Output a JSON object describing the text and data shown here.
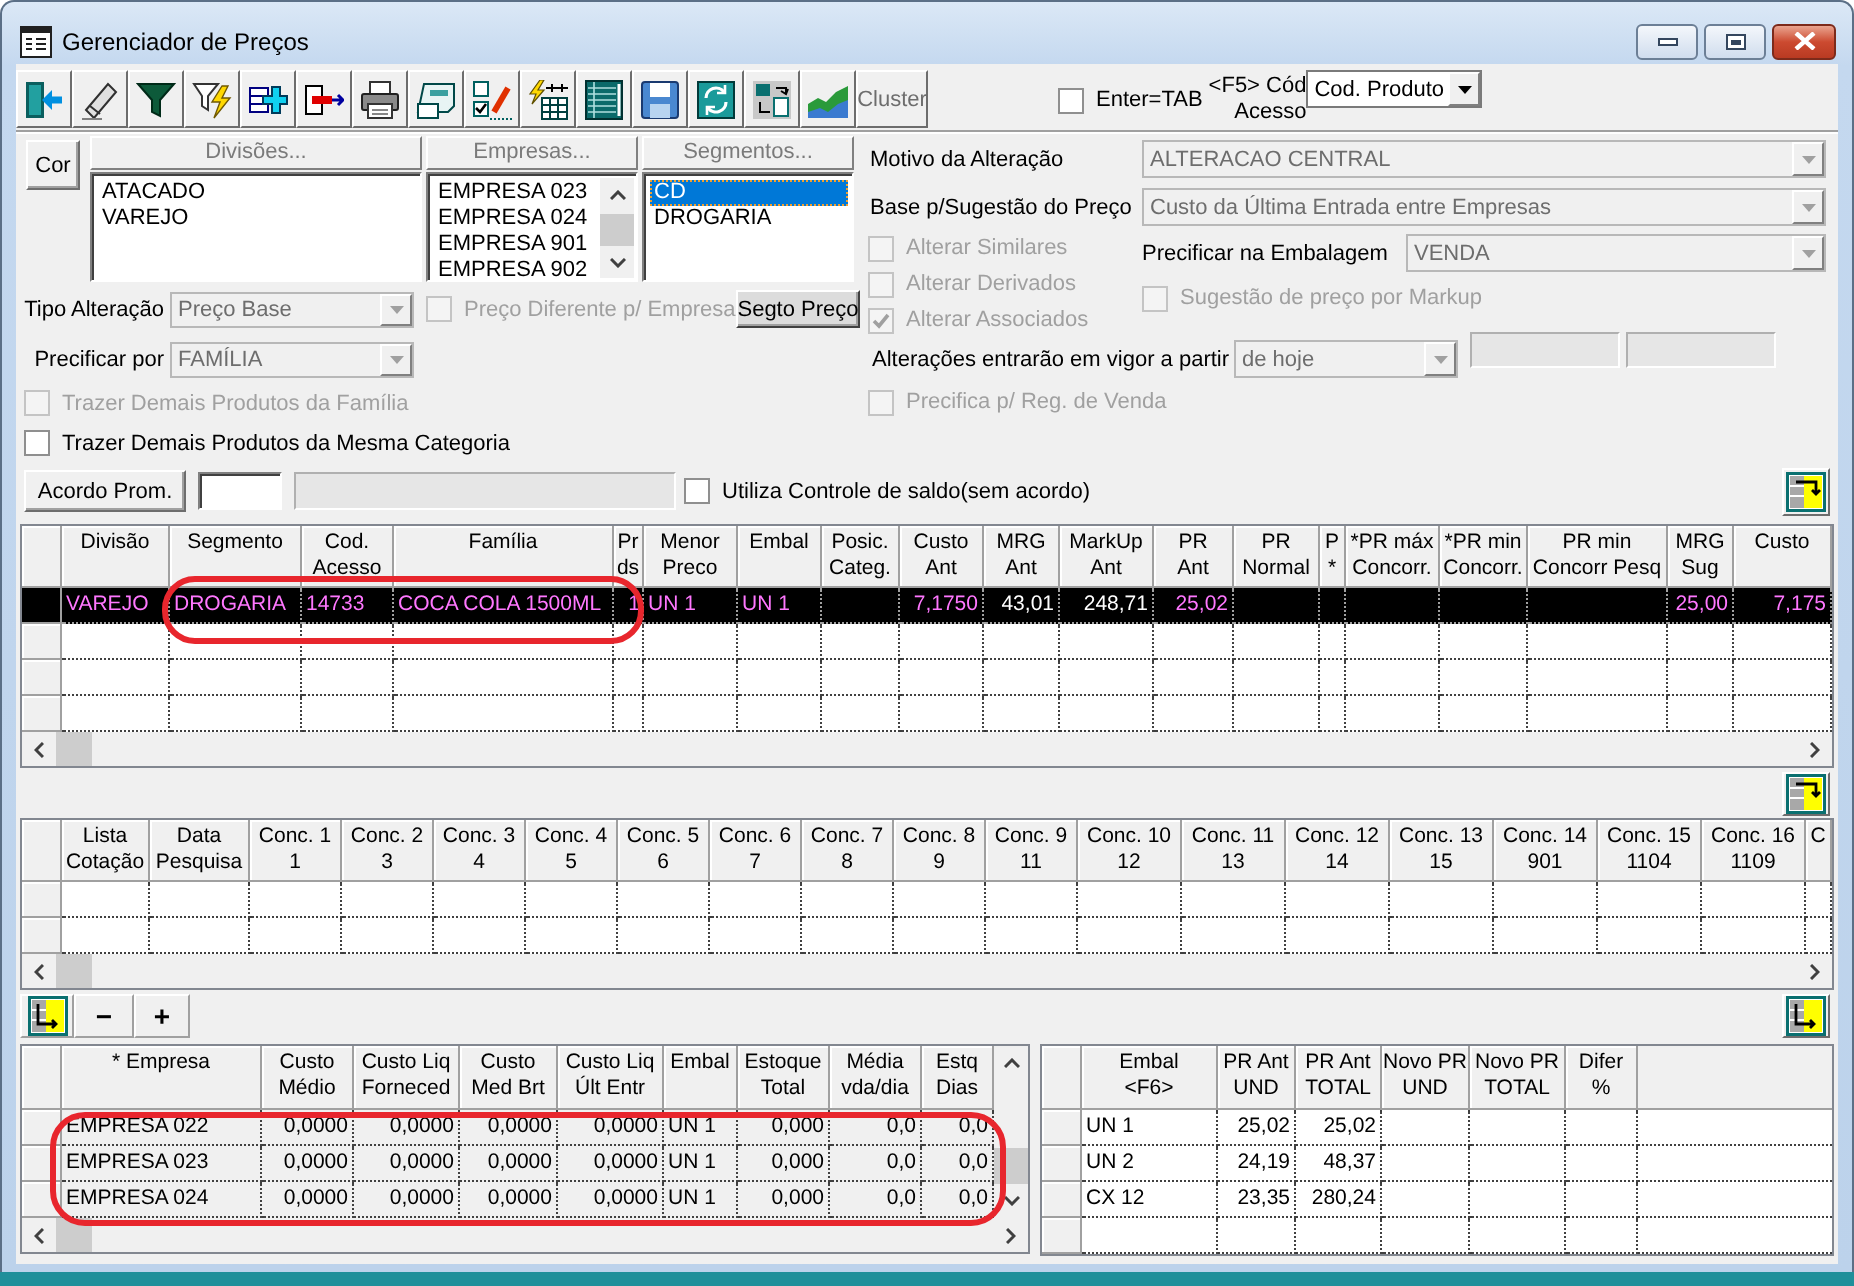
{
  "window": {
    "title": "Gerenciador de Preços"
  },
  "toolbar": {
    "buttons": [
      {
        "kind": "exit"
      },
      {
        "kind": "eraser"
      },
      {
        "kind": "filter"
      },
      {
        "kind": "filter_flash"
      },
      {
        "kind": "add_row"
      },
      {
        "kind": "remove_row"
      },
      {
        "kind": "print"
      },
      {
        "kind": "form"
      },
      {
        "kind": "checklist"
      },
      {
        "kind": "flash_table"
      },
      {
        "kind": "sheet"
      },
      {
        "kind": "save"
      },
      {
        "kind": "sync"
      },
      {
        "kind": "swap"
      },
      {
        "kind": "chart"
      },
      {
        "kind": "text",
        "label": "Cluster",
        "disabled": true
      }
    ],
    "enter_tab": {
      "label": "Enter=TAB",
      "checked": false,
      "disabled": false
    },
    "access_code": {
      "label_lines": [
        "<F5> Cód",
        "Acesso"
      ],
      "value": "Cod. Produto",
      "disabled": false
    }
  },
  "filters": {
    "color_button": "Cor",
    "lists": [
      {
        "kind": "plain",
        "header": {
          "label": "Divisões...",
          "disabled": true
        },
        "items": [
          {
            "label": "ATACADO",
            "selected": false
          },
          {
            "label": "VAREJO",
            "selected": false
          }
        ]
      },
      {
        "kind": "scroll",
        "header": {
          "label": "Empresas...",
          "disabled": true
        },
        "items": [
          {
            "label": "EMPRESA 023",
            "selected": false
          },
          {
            "label": "EMPRESA 024",
            "selected": false
          },
          {
            "label": "EMPRESA 901",
            "selected": false
          },
          {
            "label": "EMPRESA 902",
            "selected": false
          }
        ]
      },
      {
        "kind": "plain",
        "header": {
          "label": "Segmentos...",
          "disabled": true
        },
        "items": [
          {
            "label": "CD",
            "selected": true
          },
          {
            "label": "DROGARIA",
            "selected": false
          }
        ]
      }
    ],
    "change_type": {
      "label": "Tipo Alteração",
      "value": "Preço Base",
      "disabled": true
    },
    "different_price": {
      "label": "Preço Diferente p/ Empresa",
      "checked": false,
      "disabled": true
    },
    "segment_price_button": "Segto Preço",
    "price_by": {
      "label": "Precificar por",
      "value": "FAMÍLIA",
      "disabled": true
    },
    "bring_family": {
      "label": "Trazer Demais Produtos da Família",
      "checked": false,
      "disabled": true
    },
    "bring_category": {
      "label": "Trazer Demais Produtos da Mesma Categoria",
      "checked": false,
      "disabled": false
    },
    "promo_button": "Acordo Prom.",
    "promo_fields": [
      {
        "disabled": false
      },
      {
        "disabled": true
      }
    ],
    "balance_control": {
      "label": "Utiliza Controle de saldo(sem acordo)",
      "checked": false,
      "disabled": false
    }
  },
  "settings": {
    "reason": {
      "label": "Motivo da Alteração",
      "value": "ALTERACAO CENTRAL",
      "disabled": true
    },
    "base": {
      "label": "Base p/Sugestão do Preço",
      "value": "Custo da Última Entrada entre Empresas",
      "disabled": true
    },
    "options": [
      {
        "label": "Alterar Similares",
        "checked": false,
        "disabled": true
      },
      {
        "label": "Alterar Derivados",
        "checked": false,
        "disabled": true
      },
      {
        "label": "Alterar Associados",
        "checked": true,
        "disabled": true
      }
    ],
    "package": {
      "label": "Precificar na Embalagem",
      "value": "VENDA",
      "disabled": true
    },
    "markup_suggestion": {
      "label": "Sugestão de preço por Markup",
      "checked": false,
      "disabled": true
    },
    "effective": {
      "label": "Alterações entrarão em vigor a partir",
      "value": "de hoje",
      "disabled": true,
      "date_fields": [
        {
          "disabled": true
        },
        {
          "disabled": true
        }
      ]
    },
    "sales_region": {
      "label": "Precifica p/ Reg. de Venda",
      "checked": false,
      "disabled": true
    }
  },
  "products_grid": {
    "columns": [
      {
        "label": "Divisão",
        "kind": "text"
      },
      {
        "label": "Segmento",
        "kind": "text"
      },
      {
        "label": "Cod.\nAcesso",
        "kind": "text"
      },
      {
        "label": "Família",
        "kind": "text"
      },
      {
        "label": "Prds",
        "kind": "number"
      },
      {
        "label": "Menor\nPreco",
        "kind": "text"
      },
      {
        "label": "Embal",
        "kind": "text"
      },
      {
        "label": "Posic.\nCateg."
      },
      {
        "label": "Custo\nAnt",
        "kind": "number"
      },
      {
        "label": "MRG\nAnt",
        "kind": "calc"
      },
      {
        "label": "MarkUp\nAnt",
        "kind": "calc"
      },
      {
        "label": "PR\nAnt",
        "kind": "number"
      },
      {
        "label": "PR\nNormal"
      },
      {
        "label": "P\n*"
      },
      {
        "label": "*PR máx\nConcorr."
      },
      {
        "label": "*PR min\nConcorr."
      },
      {
        "label": "PR min\nConcorr Pesq"
      },
      {
        "label": "MRG\nSug",
        "kind": "number"
      },
      {
        "label": "Custo",
        "kind": "number"
      }
    ],
    "rows": [
      {
        "selected": true,
        "cells": [
          "VAREJO",
          "DROGARIA",
          "14733",
          "COCA COLA 1500ML",
          "1",
          "UN 1",
          "UN 1",
          null,
          "7,1750",
          "43,01",
          "248,71",
          "25,02",
          null,
          null,
          null,
          null,
          null,
          "25,00",
          "7,175"
        ]
      }
    ]
  },
  "competitors_grid": {
    "columns": [
      "Lista\nCotação",
      "Data\nPesquisa",
      "Conc. 1\n1",
      "Conc. 2\n3",
      "Conc. 3\n4",
      "Conc. 4\n5",
      "Conc. 5\n6",
      "Conc. 6\n7",
      "Conc. 7\n8",
      "Conc. 8\n9",
      "Conc. 9\n11",
      "Conc. 10\n12",
      "Conc. 11\n13",
      "Conc. 12\n14",
      "Conc. 13\n15",
      "Conc. 14\n901",
      "Conc. 15\n1104",
      "Conc. 16\n1109",
      "C"
    ]
  },
  "grid_tools": {
    "buttons": [
      {
        "kind": "icon"
      },
      {
        "kind": "text",
        "label": "−"
      },
      {
        "kind": "text",
        "label": "+"
      }
    ]
  },
  "stock_grid": {
    "columns": [
      {
        "label": "* Empresa",
        "kind": "text"
      },
      {
        "label": "Custo\nMédio",
        "kind": "number"
      },
      {
        "label": "Custo Liq\nForneced",
        "kind": "number"
      },
      {
        "label": "Custo\nMed Brt",
        "kind": "number"
      },
      {
        "label": "Custo Liq\nÚlt Entr",
        "kind": "number"
      },
      {
        "label": "Embal",
        "kind": "text"
      },
      {
        "label": "Estoque\nTotal",
        "kind": "number"
      },
      {
        "label": "Média\nvda/dia",
        "kind": "number"
      },
      {
        "label": "Estq\nDias",
        "kind": "number"
      }
    ],
    "rows": [
      {
        "selected": false,
        "cells": [
          "EMPRESA 022",
          "0,0000",
          "0,0000",
          "0,0000",
          "0,0000",
          "UN 1",
          "0,000",
          "0,0",
          "0,0"
        ]
      },
      {
        "selected": false,
        "cells": [
          "EMPRESA 023",
          "0,0000",
          "0,0000",
          "0,0000",
          "0,0000",
          "UN 1",
          "0,000",
          "0,0",
          "0,0"
        ]
      },
      {
        "selected": false,
        "cells": [
          "EMPRESA 024",
          "0,0000",
          "0,0000",
          "0,0000",
          "0,0000",
          "UN 1",
          "0,000",
          "0,0",
          "0,0"
        ]
      }
    ]
  },
  "packaging_grid": {
    "columns": [
      {
        "label": "Embal\n<F6>",
        "kind": "text"
      },
      {
        "label": "PR Ant\nUND",
        "kind": "number"
      },
      {
        "label": "PR Ant\nTOTAL",
        "kind": "number"
      },
      {
        "label": "Novo PR\nUND"
      },
      {
        "label": "Novo PR\nTOTAL"
      },
      {
        "label": "Difer\n%"
      }
    ],
    "rows": [
      {
        "selected": false,
        "cells": [
          "UN 1",
          "25,02",
          "25,02"
        ]
      },
      {
        "selected": false,
        "cells": [
          "UN 2",
          "24,19",
          "48,37"
        ]
      },
      {
        "selected": false,
        "cells": [
          "CX 12",
          "23,35",
          "280,24"
        ]
      }
    ]
  }
}
